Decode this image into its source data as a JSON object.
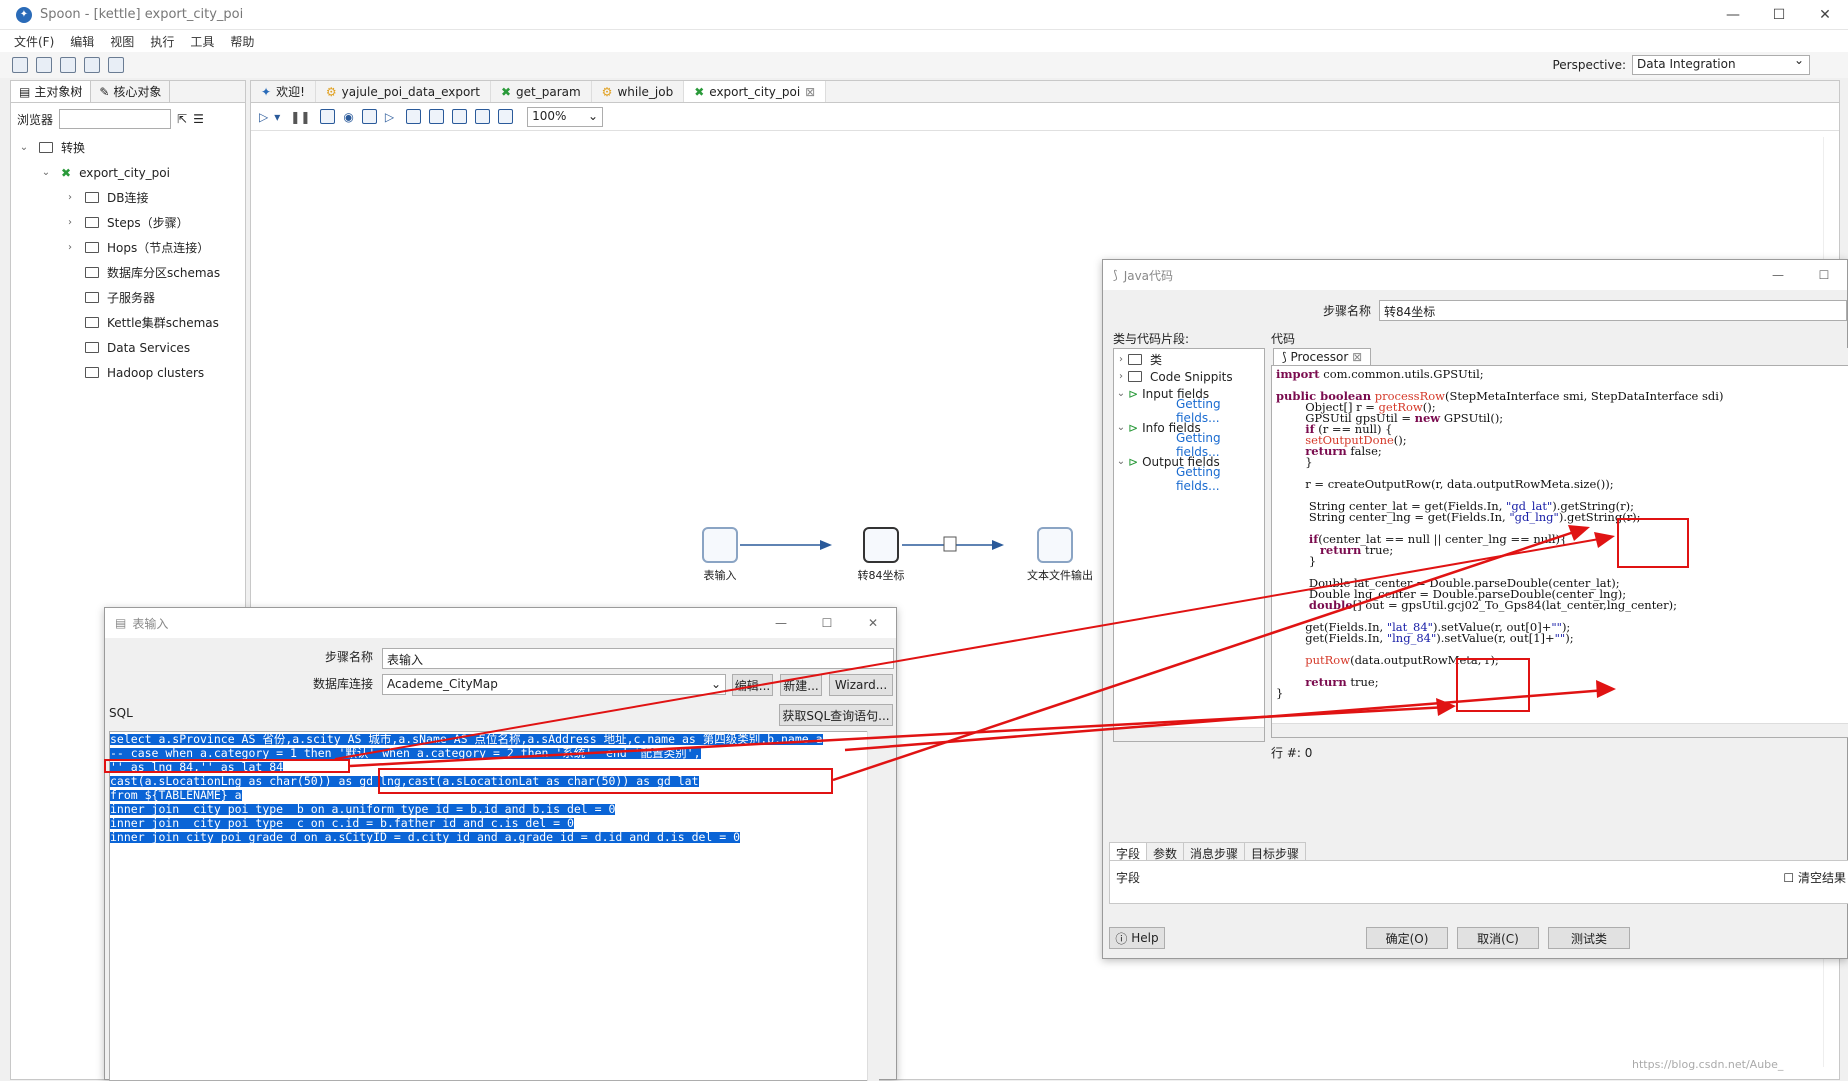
{
  "window": {
    "title": "Spoon - [kettle] export_city_poi"
  },
  "menu": [
    "文件(F)",
    "编辑",
    "视图",
    "执行",
    "工具",
    "帮助"
  ],
  "perspective": {
    "label": "Perspective:",
    "value": "Data Integration"
  },
  "left": {
    "tabs": [
      "主对象树",
      "核心对象"
    ],
    "browse_label": "浏览器",
    "tree": {
      "root": "转换",
      "trans": "export_city_poi",
      "items": [
        "DB连接",
        "Steps（步骤）",
        "Hops（节点连接）",
        "数据库分区schemas",
        "子服务器",
        "Kettle集群schemas",
        "Data Services",
        "Hadoop clusters"
      ]
    }
  },
  "canvas": {
    "tabs": [
      "欢迎!",
      "yajule_poi_data_export",
      "get_param",
      "while_job",
      "export_city_poi"
    ],
    "zoom": "100%",
    "nodes": [
      "表输入",
      "转84坐标",
      "文本文件输出"
    ]
  },
  "table_input": {
    "title": "表输入",
    "step_label": "步骤名称",
    "step_value": "表输入",
    "db_label": "数据库连接",
    "db_value": "Academe_CityMap",
    "btn_edit": "编辑...",
    "btn_new": "新建...",
    "btn_wizard": "Wizard...",
    "sql_label": "SQL",
    "btn_getsql": "获取SQL查询语句...",
    "sql_lines": [
      "select a.sProvince AS 省份,a.scity AS 城市,a.sName AS 点位名称,a.sAddress 地址,c.name as 第四级类别,b.name a",
      "-- case when a.category = 1 then '默认' when a.category = 2 then '系统'  end '配置类别',",
      "'' as lng_84,'' as lat_84",
      "cast(a.sLocationLng as char(50)) as gd_lng,cast(a.sLocationLat as char(50)) as gd_lat",
      "from ${TABLENAME} a",
      "inner join  city_poi_type  b on a.uniform_type_id = b.id and b.is_del = 0",
      "inner join  city_poi_type  c on c.id = b.father_id and c.is_del = 0",
      "inner join city_poi_grade d on a.sCityID = d.city_id and a.grade_id = d.id and d.is_del = 0"
    ]
  },
  "java": {
    "title": "Java代码",
    "step_label": "步骤名称",
    "step_value": "转84坐标",
    "snippets_label": "类与代码片段:",
    "code_label": "代码",
    "snippets": {
      "class": "类",
      "code_snippits": "Code Snippits",
      "input": "Input fields",
      "info": "Info fields",
      "output": "Output fields",
      "getting": "Getting fields..."
    },
    "code_tab": "Processor",
    "row_label": "行 #: 0",
    "bottom_tabs": [
      "字段",
      "参数",
      "消息步骤",
      "目标步骤"
    ],
    "field_label": "字段",
    "clear_label": "清空结果",
    "help": "Help",
    "ok": "确定(O)",
    "cancel": "取消(C)",
    "test": "测试类"
  },
  "watermark": "https://blog.csdn.net/Aube_"
}
